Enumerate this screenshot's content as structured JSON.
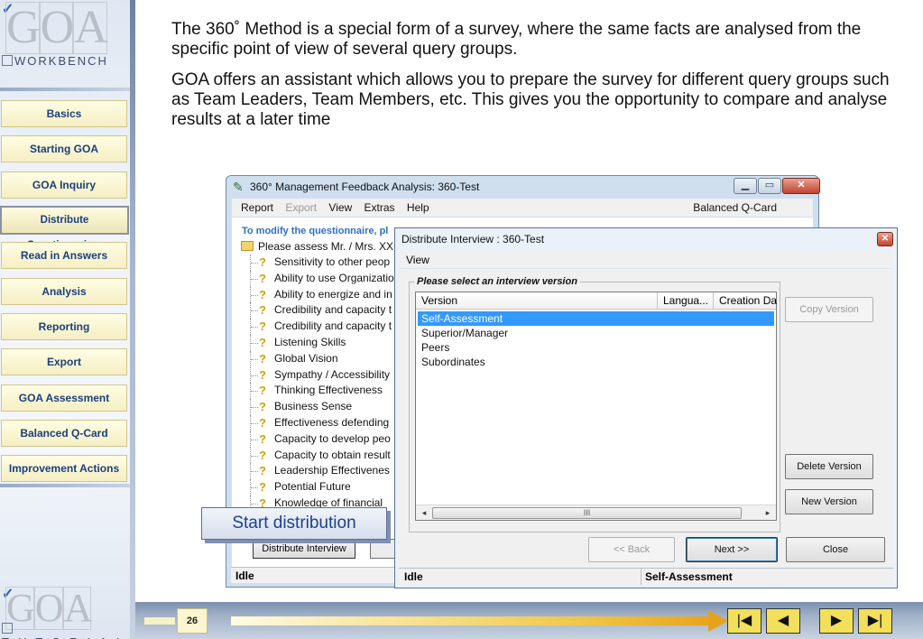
{
  "sidebar": {
    "logo_top_text": "WORKBENCH",
    "logo_bottom_text": "TUTORIAL",
    "items": [
      {
        "label": "Basics"
      },
      {
        "label": "Starting GOA"
      },
      {
        "label": "GOA Inquiry"
      },
      {
        "label": "Distribute Questionnaires"
      },
      {
        "label": "Read in Answers"
      },
      {
        "label": "Analysis"
      },
      {
        "label": "Reporting"
      },
      {
        "label": "Export"
      },
      {
        "label": "GOA Assessment"
      },
      {
        "label": "Balanced Q-Card"
      },
      {
        "label": "Improvement Actions"
      }
    ],
    "active_index": 3
  },
  "intro": {
    "p1": "The 360˚   Method is a special form of a survey, where the same facts are analysed from the specific point of view of several query groups.",
    "p2": "GOA offers an assistant which allows you to prepare the survey for different query groups such as Team Leaders, Team Members, etc. This gives you the opportunity to compare and analyse results at a later time"
  },
  "main_window": {
    "title": "360° Management Feedback Analysis: 360-Test",
    "menu": {
      "report": "Report",
      "export": "Export",
      "view": "View",
      "extras": "Extras",
      "help": "Help",
      "right": "Balanced Q-Card"
    },
    "hint": "To modify the questionnaire, pl",
    "tree_root": "Please assess Mr. / Mrs. XX",
    "tree_items": [
      "Sensitivity to other peop",
      "Ability to use Organizatio",
      "Ability to energize and in",
      "Credibility and capacity t",
      "Credibility and capacity t",
      "Listening Skills",
      "Global Vision",
      "Sympathy / Accessibility",
      "Thinking Effectiveness",
      "Business Sense",
      "Effectiveness defending",
      "Capacity to develop peo",
      "Capacity to obtain result",
      "Leadership Effectivenes",
      "Potential Future",
      "Knowledge of financial"
    ],
    "distribute_button": "Distribute Interview",
    "status": "Idle"
  },
  "callout": "Start distribution",
  "dialog": {
    "title": "Distribute Interview :  360-Test",
    "menu_view": "View",
    "group_label": "Please select an interview version",
    "columns": [
      "Version",
      "Langua...",
      "Creation Da"
    ],
    "rows": [
      "Self-Assessment",
      "Superior/Manager",
      "Peers",
      "Subordinates"
    ],
    "selected_row": 0,
    "scroll_thumb": "III",
    "buttons": {
      "copy": "Copy Version",
      "delete": "Delete Version",
      "new": "New Version",
      "back": "<< Back",
      "next": "Next >>",
      "close": "Close"
    },
    "status_left": "Idle",
    "status_right": "Self-Assessment"
  },
  "footer": {
    "page_number": "26"
  }
}
